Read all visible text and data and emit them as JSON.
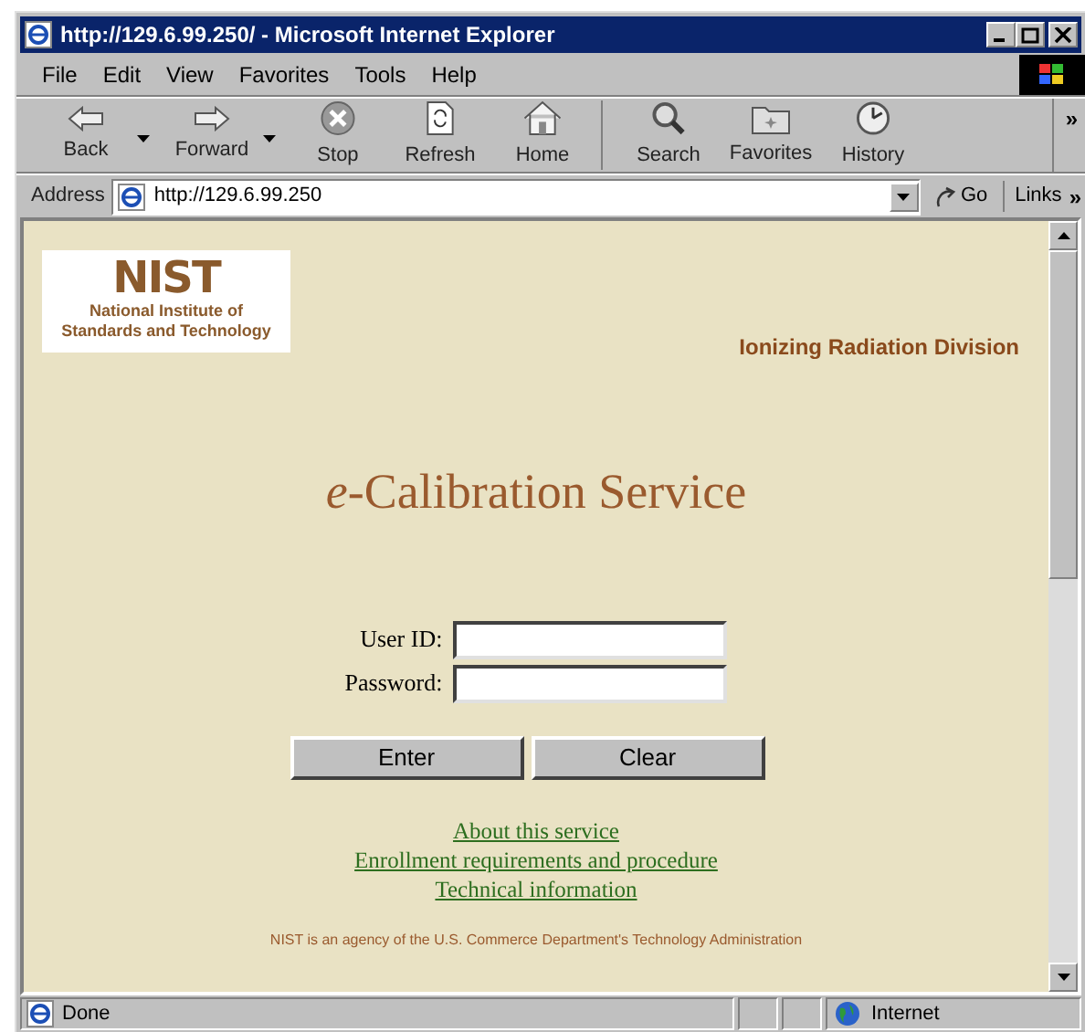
{
  "window": {
    "title": "http://129.6.99.250/ - Microsoft Internet Explorer"
  },
  "menu": [
    "File",
    "Edit",
    "View",
    "Favorites",
    "Tools",
    "Help"
  ],
  "toolbar": [
    {
      "label": "Back",
      "kind": "back",
      "dropdown": true
    },
    {
      "label": "Forward",
      "kind": "forward",
      "dropdown": true
    },
    {
      "label": "Stop",
      "kind": "stop",
      "dropdown": false
    },
    {
      "label": "Refresh",
      "kind": "refresh",
      "dropdown": false
    },
    {
      "label": "Home",
      "kind": "home",
      "dropdown": false
    },
    {
      "label": "Search",
      "kind": "search",
      "dropdown": false
    },
    {
      "label": "Favorites",
      "kind": "favorites",
      "dropdown": false
    },
    {
      "label": "History",
      "kind": "history",
      "dropdown": false
    }
  ],
  "toolbar_overflow": "»",
  "address_bar": {
    "label": "Address",
    "value": "http://129.6.99.250",
    "go": "Go",
    "links": "Links",
    "links_overflow": "»"
  },
  "page": {
    "logo": {
      "acronym": "NIST",
      "name_line_1": "National Institute of",
      "name_line_2": "Standards and Technology"
    },
    "division": "Ionizing Radiation Division",
    "heading": "*e*-Calibration Service",
    "fields": [
      {
        "label": "User ID:"
      },
      {
        "label": "Password:"
      }
    ],
    "buttons": [
      "Enter",
      "Clear"
    ],
    "links": [
      "About this service",
      "Enrollment requirements and procedure",
      "Technical information"
    ],
    "footer": "NIST is an agency of the U.S. Commerce Department's Technology Administration"
  },
  "status_bar": {
    "text": "Done",
    "zone": "Internet"
  }
}
